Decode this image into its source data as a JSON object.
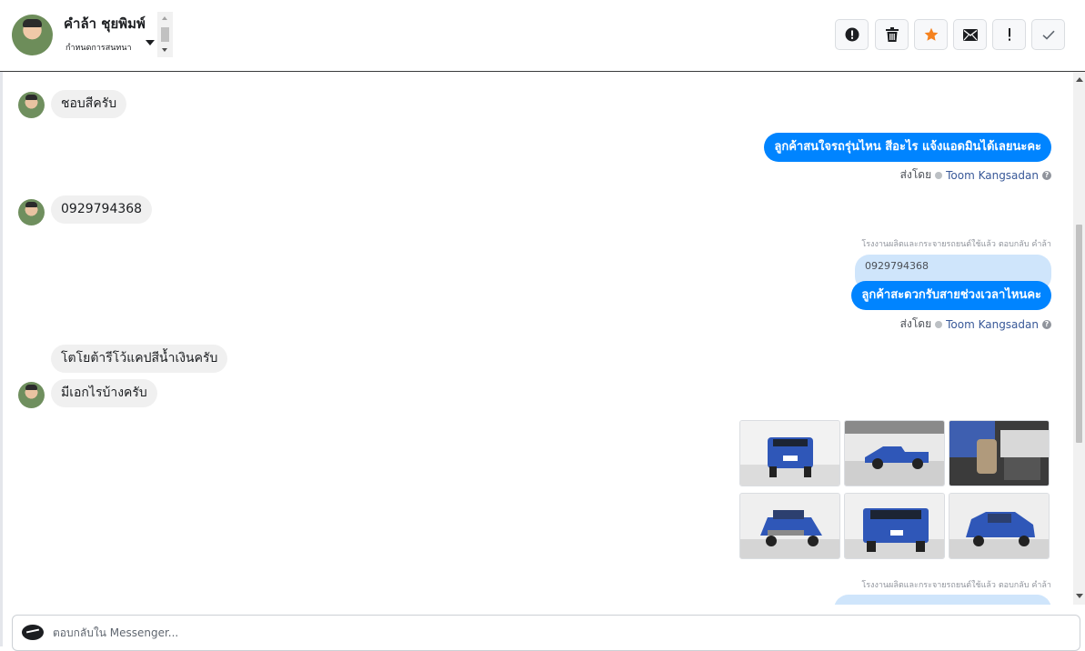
{
  "header": {
    "contact_name": "คำล้า ชุยพิมพ์",
    "conversation_label": "กำหนดการสนทนา",
    "actions": [
      {
        "name": "mark-spam-button",
        "icon": "exclamation-circle-icon"
      },
      {
        "name": "delete-button",
        "icon": "trash-icon"
      },
      {
        "name": "star-button",
        "icon": "star-icon"
      },
      {
        "name": "mark-unread-button",
        "icon": "envelope-icon"
      },
      {
        "name": "follow-up-button",
        "icon": "exclamation-icon"
      },
      {
        "name": "mark-done-button",
        "icon": "checkmark-icon"
      }
    ]
  },
  "conversation": {
    "messages": [
      {
        "direction": "in",
        "text": "ชอบสีครับ"
      },
      {
        "direction": "out",
        "text": "ลูกค้าสนใจรถรุ่นไหน สีอะไร แจ้งแอดมินได้เลยนะคะ",
        "sent_by_label": "ส่งโดย",
        "agent": "Toom Kangsadan"
      },
      {
        "direction": "in",
        "text": "0929794368"
      },
      {
        "direction": "out",
        "reply_caption": "โรงงานผลิตและกระจายรถยนต์ใช้แล้ว ตอบกลับ คำล้า",
        "quoted_text": "0929794368",
        "text": "ลูกค้าสะดวกรับสายช่วงเวลาไหนคะ",
        "sent_by_label": "ส่งโดย",
        "agent": "Toom Kangsadan"
      },
      {
        "direction": "in",
        "text": "โตโยต้ารีโว้แคปสีน้ำเงินครับ"
      },
      {
        "direction": "in",
        "text": "มีเอกไรบ้างครับ"
      },
      {
        "direction": "out",
        "type": "image-gallery",
        "image_count": 6
      },
      {
        "direction": "out",
        "reply_caption": "โรงงานผลิตและกระจายรถยนต์ใช้แล้ว ตอบกลับ คำล้า"
      }
    ]
  },
  "composer": {
    "placeholder": "ตอบกลับใน Messenger..."
  },
  "colors": {
    "outgoing_bubble": "#0084ff",
    "incoming_bubble": "#f0f0f0",
    "quoted_bubble": "#cfe5fb",
    "star_accent": "#f5821f",
    "agent_link": "#385898"
  }
}
